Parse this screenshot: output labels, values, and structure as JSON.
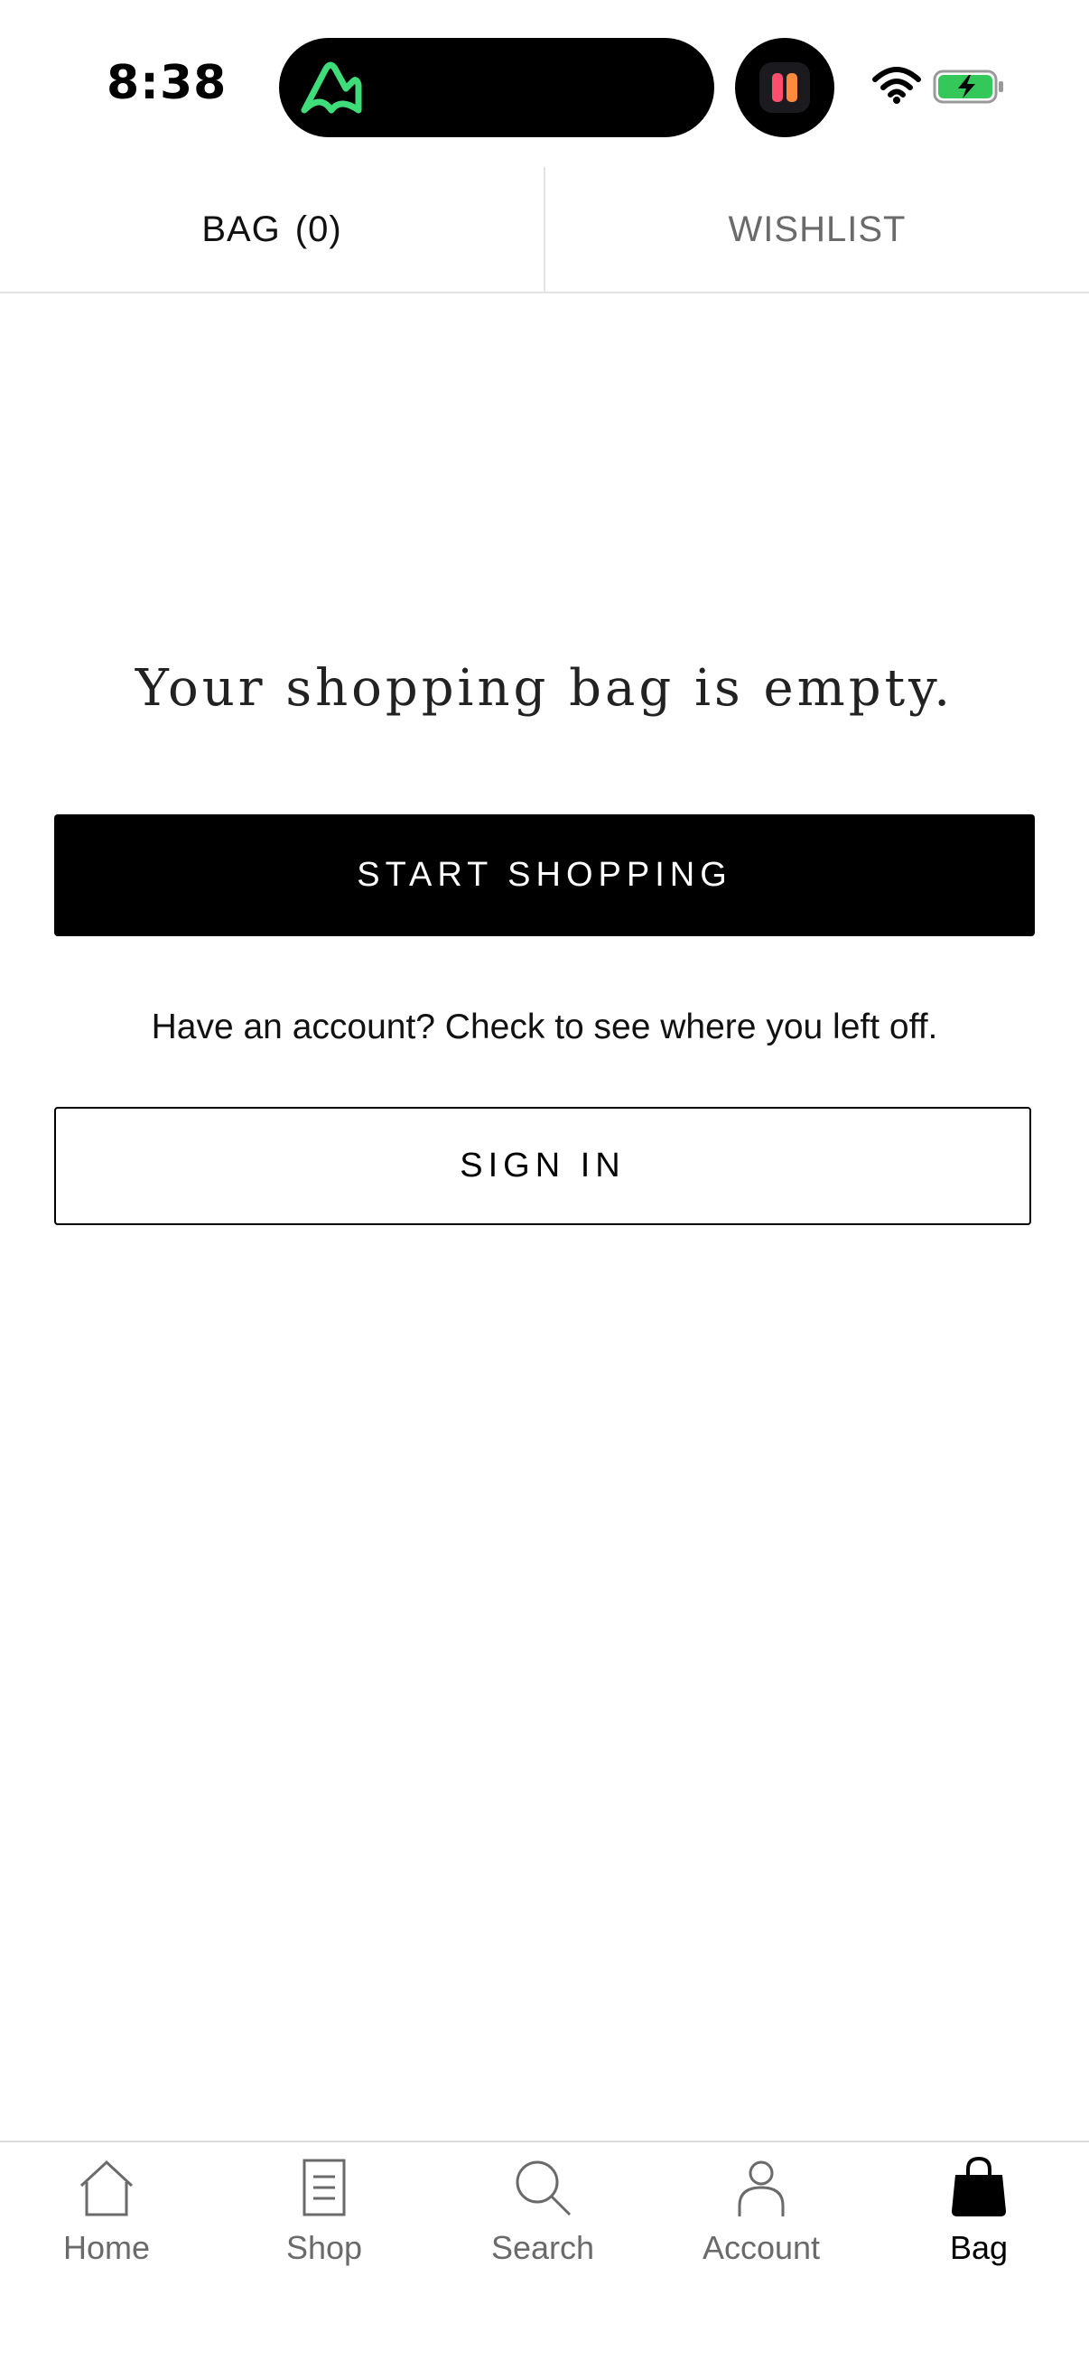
{
  "status_bar": {
    "time": "8:38"
  },
  "tabs": {
    "bag_label": "BAG",
    "bag_count": "(0)",
    "wishlist_label": "WISHLIST"
  },
  "main": {
    "empty_message": "Your shopping bag is empty.",
    "start_shopping_label": "START SHOPPING",
    "account_prompt": "Have an account? Check to see where you left off.",
    "sign_in_label": "SIGN IN"
  },
  "bottom_nav": {
    "items": [
      {
        "label": "Home",
        "icon": "home-icon"
      },
      {
        "label": "Shop",
        "icon": "shop-list-icon"
      },
      {
        "label": "Search",
        "icon": "search-icon"
      },
      {
        "label": "Account",
        "icon": "person-icon"
      },
      {
        "label": "Bag",
        "icon": "bag-icon",
        "active": true
      }
    ]
  },
  "colors": {
    "primary": "#000000",
    "inactive_text": "#6a6a6a",
    "divider": "#e2e2e2",
    "island_app_accent": "#3fdc7a",
    "battery_green": "#34c759"
  }
}
